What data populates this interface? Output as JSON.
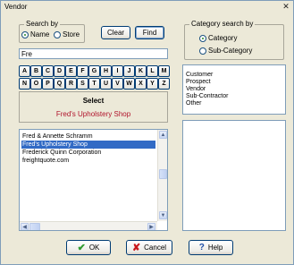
{
  "window": {
    "title": "Vendor",
    "close_glyph": "✕"
  },
  "search_by": {
    "legend": "Search by",
    "options": [
      "Name",
      "Store"
    ],
    "selected": "Name"
  },
  "buttons": {
    "clear": "Clear",
    "find": "Find"
  },
  "search_input": {
    "value": "Fre"
  },
  "alphabet_row1": [
    "A",
    "B",
    "C",
    "D",
    "E",
    "F",
    "G",
    "H",
    "I",
    "J",
    "K",
    "L",
    "M"
  ],
  "alphabet_row2": [
    "N",
    "O",
    "P",
    "Q",
    "R",
    "S",
    "T",
    "U",
    "V",
    "W",
    "X",
    "Y",
    "Z"
  ],
  "select_pane": {
    "label": "Select",
    "selected_name": "Fred's Upholstery Shop",
    "selected_color": "#b0122a"
  },
  "results_list": {
    "items": [
      "Fred & Annette Schramm",
      "Fred's Upholstery Shop",
      "Frederick Quinn Corporation",
      "freightquote.com"
    ],
    "selected_index": 1
  },
  "category_search": {
    "legend": "Category search by",
    "options": [
      "Category",
      "Sub-Category"
    ],
    "selected": "Category"
  },
  "category_list": {
    "items": [
      "Customer",
      "Prospect",
      "Vendor",
      "Sub-Contractor",
      "Other"
    ]
  },
  "footer": {
    "ok": "OK",
    "cancel": "Cancel",
    "help": "Help"
  },
  "colors": {
    "accent": "#316ac5",
    "ok_icon": "#2e9a2e",
    "cancel_icon": "#c8191e",
    "help_icon": "#1f4fa8"
  }
}
